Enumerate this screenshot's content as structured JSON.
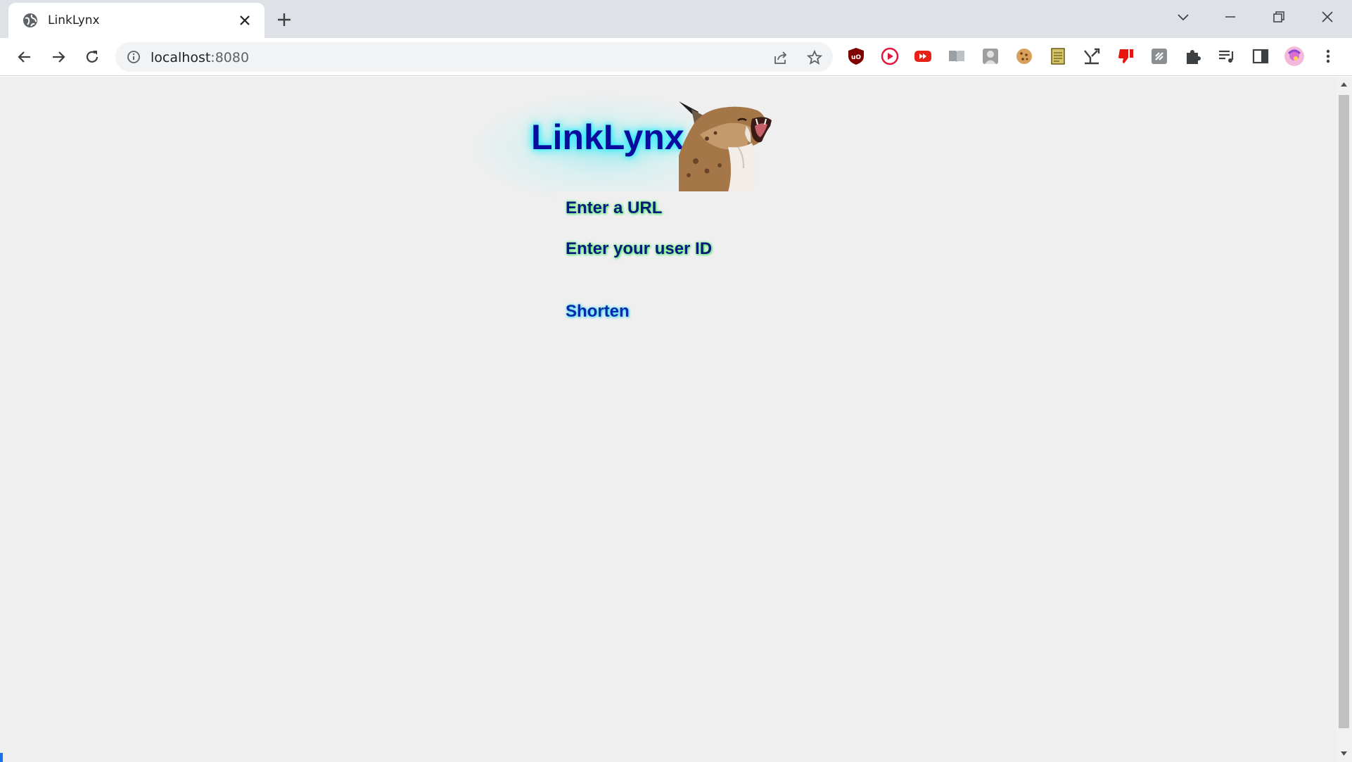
{
  "browser": {
    "tab": {
      "title": "LinkLynx"
    },
    "address_bar": {
      "url_host": "localhost",
      "url_port": ":8080"
    }
  },
  "page": {
    "logo_title": "LinkLynx",
    "form": {
      "url_label": "Enter a URL",
      "userid_label": "Enter your user ID",
      "submit_label": "Shorten"
    }
  },
  "colors": {
    "title": "#0b0b9e",
    "title_glow": "#15e7ff",
    "label_text": "#0b1a7a",
    "label_glow": "#6dff86",
    "button_text": "#0a2aa8",
    "page_background": "#efefef"
  },
  "icons": {
    "tab_favicon": "globe-icon",
    "tab_close": "close-icon",
    "new_tab": "plus-icon",
    "back": "arrow-left-icon",
    "forward": "arrow-right-icon",
    "reload": "reload-icon",
    "site_info": "info-icon",
    "share": "share-icon",
    "bookmark": "star-icon",
    "extensions": [
      "ublock-icon",
      "play-circle-icon",
      "youtube-icon",
      "book-icon",
      "portrait-icon",
      "cookie-icon",
      "notepad-icon",
      "merge-icon",
      "thumbs-down-icon",
      "slash-icon",
      "puzzle-icon",
      "media-queue-icon",
      "side-panel-icon",
      "profile-avatar-icon",
      "kebab-menu-icon"
    ]
  }
}
